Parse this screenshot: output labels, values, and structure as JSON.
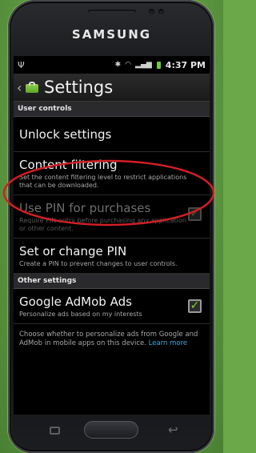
{
  "device": {
    "brand": "SAMSUNG"
  },
  "status_bar": {
    "time": "4:37 PM",
    "icons": [
      "usb-icon",
      "bluetooth-icon",
      "wifi-icon",
      "signal-icon",
      "battery-icon"
    ]
  },
  "action_bar": {
    "title": "Settings",
    "icon": "shopping-bag-icon"
  },
  "sections": [
    {
      "header": "User controls",
      "items": [
        {
          "label": "Unlock settings",
          "sub": "",
          "enabled": true
        },
        {
          "label": "Content filtering",
          "sub": "Set the content filtering level to restrict applications that can be downloaded.",
          "enabled": true
        },
        {
          "label": "Use PIN for purchases",
          "sub": "Require PIN entry before purchasing any application or other content.",
          "enabled": false,
          "checked": true
        },
        {
          "label": "Set or change PIN",
          "sub": "Create a PIN to prevent changes to user controls.",
          "enabled": true
        }
      ]
    },
    {
      "header": "Other settings",
      "items": [
        {
          "label": "Google AdMob Ads",
          "sub": "Personalize ads based on my interests",
          "enabled": true,
          "checked": true
        }
      ]
    }
  ],
  "ads_info": {
    "text": "Choose whether to personalize ads from Google and AdMob in mobile apps on this device.",
    "link": "Learn more"
  },
  "annotation_color": "#d21f25",
  "accent": "#7bdc2a"
}
